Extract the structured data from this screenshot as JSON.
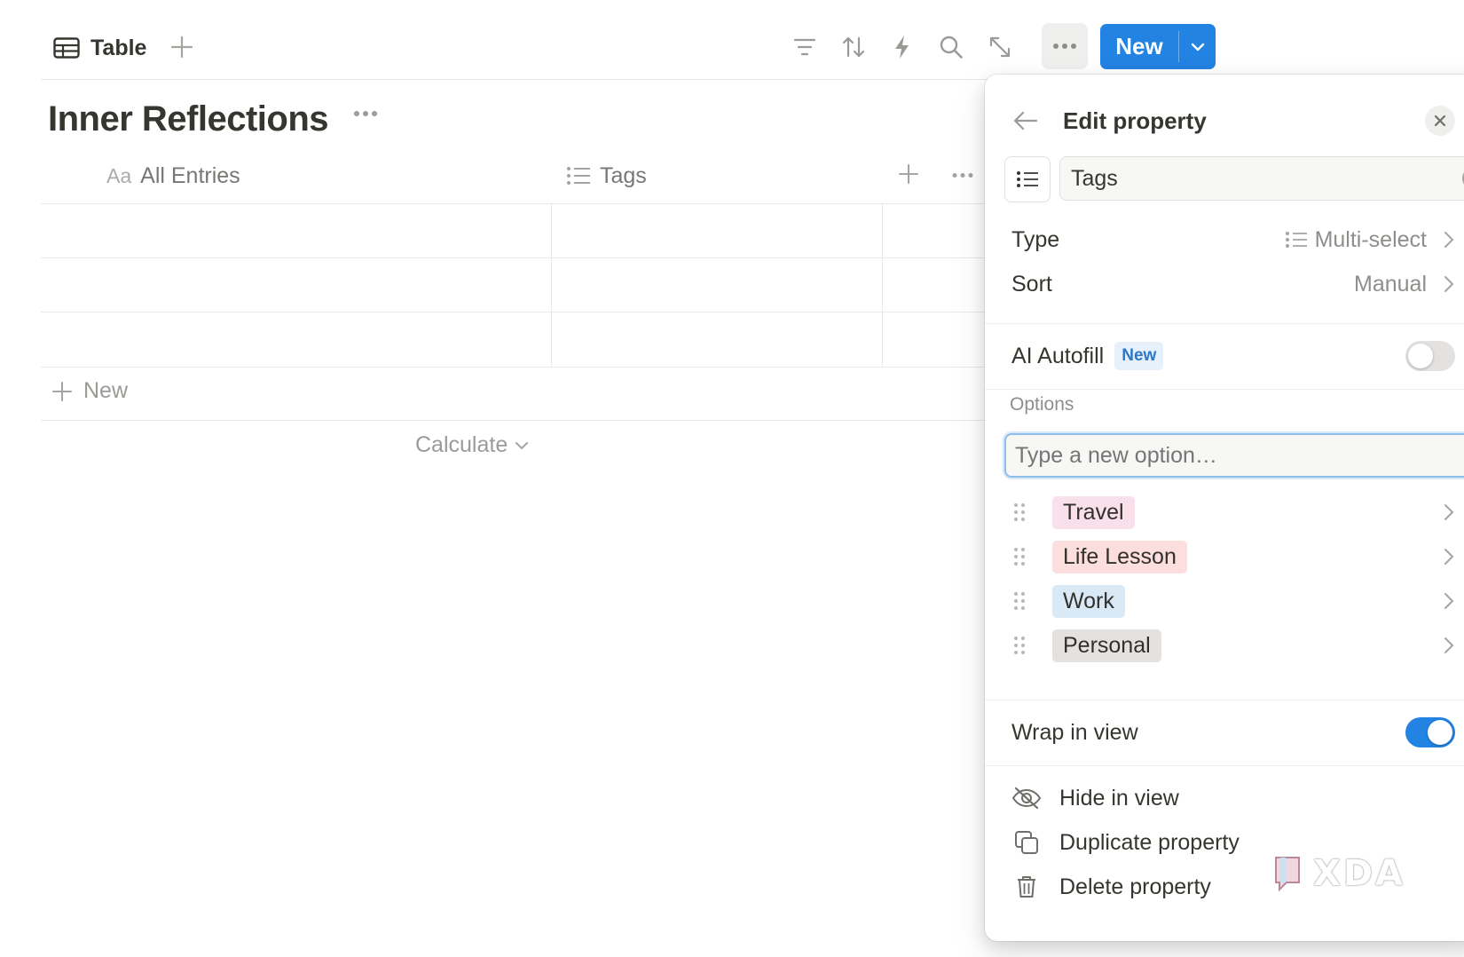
{
  "toolbar": {
    "view_tab_label": "Table",
    "icons": [
      "filter-icon",
      "sort-icon",
      "automation-icon",
      "search-icon",
      "expand-icon",
      "more-icon"
    ],
    "new_button_label": "New"
  },
  "page": {
    "title": "Inner Reflections"
  },
  "table": {
    "columns": [
      {
        "icon": "Aa",
        "label": "All Entries"
      },
      {
        "icon": "multi-select-icon",
        "label": "Tags"
      }
    ],
    "row_count": 3,
    "add_row_label": "New",
    "calculate_label": "Calculate"
  },
  "edit_property": {
    "title": "Edit property",
    "name_value": "Tags",
    "type_label": "Type",
    "type_value": "Multi-select",
    "sort_label": "Sort",
    "sort_value": "Manual",
    "ai_autofill_label": "AI Autofill",
    "ai_autofill_badge": "New",
    "ai_autofill_enabled": false,
    "options_heading": "Options",
    "new_option_placeholder": "Type a new option…",
    "options": [
      {
        "label": "Travel",
        "bg": "#f9e0ea"
      },
      {
        "label": "Life Lesson",
        "bg": "#fcdede"
      },
      {
        "label": "Work",
        "bg": "#d9e9f5"
      },
      {
        "label": "Personal",
        "bg": "#e3e2e0"
      }
    ],
    "wrap_label": "Wrap in view",
    "wrap_enabled": true,
    "actions": [
      {
        "label": "Hide in view",
        "icon": "eye-off-icon"
      },
      {
        "label": "Duplicate property",
        "icon": "duplicate-icon"
      },
      {
        "label": "Delete property",
        "icon": "trash-icon"
      }
    ]
  },
  "colors": {
    "accent": "#2383e2",
    "text": "#37352f",
    "muted": "#9b9a97"
  },
  "watermark": "XDA"
}
